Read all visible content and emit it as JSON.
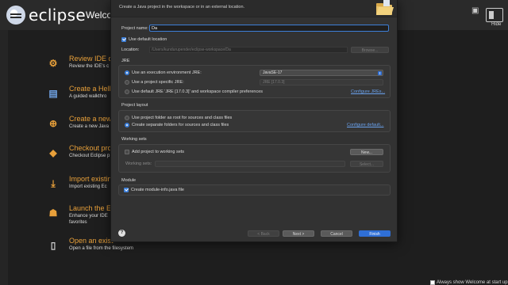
{
  "app": {
    "logo_text": "eclipse",
    "welcome_title": "Welcome",
    "hide_label": "Hide",
    "show_welcome_checkbox_label": "Always show Welcome at start up"
  },
  "welcome_items": [
    {
      "title": "Review IDE co",
      "desc": "Review the IDE's c",
      "icon": "gear-icon"
    },
    {
      "title": "Create a Hello",
      "desc": "A guided walkthro",
      "icon": "hello-world-icon"
    },
    {
      "title": "Create a new",
      "desc": "Create a new Java",
      "icon": "plus-circle-icon"
    },
    {
      "title": "Checkout proj",
      "desc": "Checkout Eclipse p",
      "icon": "git-icon"
    },
    {
      "title": "Import existin",
      "desc": "Import existing Ec",
      "icon": "import-icon"
    },
    {
      "title": "Launch the Ec",
      "desc": "Enhance your IDE",
      "desc2": "favorites",
      "icon": "marketplace-icon"
    },
    {
      "title": "Open an exist",
      "desc": "Open a file from the filesystem",
      "icon": "file-icon"
    }
  ],
  "dialog": {
    "subtitle": "Create a Java project in the workspace or in an external location.",
    "project_name_label": "Project name:",
    "project_name_value": "Da",
    "use_default_location_label": "Use default location",
    "location_label": "Location:",
    "location_value": "/Users/kundurupender/eclipse-workspace/Da",
    "browse_label": "Browse...",
    "jre": {
      "title": "JRE",
      "option_exec_env": "Use an execution environment JRE:",
      "exec_env_value": "JavaSE-17",
      "option_project_specific": "Use a project specific JRE:",
      "project_specific_value": "JRE [17.0.3]",
      "option_default": "Use default JRE 'JRE [17.0.3]' and workspace compiler preferences",
      "configure_link": "Configure JREs..."
    },
    "layout": {
      "title": "Project layout",
      "option_root": "Use project folder as root for sources and class files",
      "option_separate": "Create separate folders for sources and class files",
      "configure_link": "Configure default..."
    },
    "working_sets": {
      "title": "Working sets",
      "add_label": "Add project to working sets",
      "new_button": "New...",
      "sets_label": "Working sets:",
      "select_button": "Select..."
    },
    "module": {
      "title": "Module",
      "create_module_label": "Create module-info.java file"
    },
    "buttons": {
      "help": "?",
      "back": "< Back",
      "next": "Next >",
      "cancel": "Cancel",
      "finish": "Finish"
    }
  }
}
